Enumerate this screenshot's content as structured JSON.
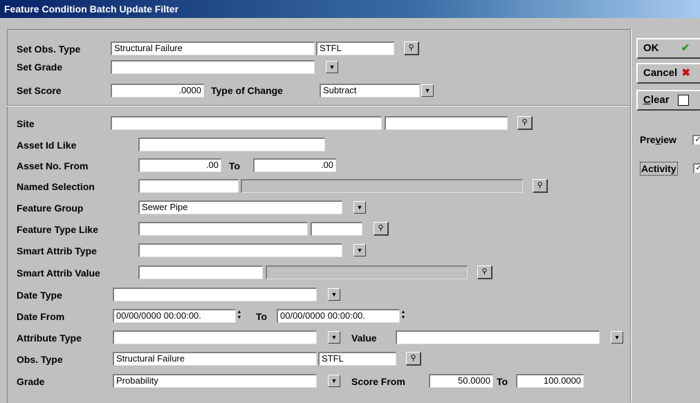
{
  "window": {
    "title": "Feature Condition Batch Update Filter"
  },
  "set": {
    "obs_type_label": "Set Obs. Type",
    "obs_type_value": "Structural Failure",
    "obs_type_code": "STFL",
    "grade_label": "Set Grade",
    "grade_value": "",
    "score_label": "Set Score",
    "score_value": ".0000",
    "change_label": "Type of Change",
    "change_value": "Subtract"
  },
  "filter": {
    "site_label": "Site",
    "site_value": "",
    "site_code": "",
    "asset_id_label": "Asset Id Like",
    "asset_id_value": "",
    "asset_no_label": "Asset No. From",
    "asset_no_from": ".00",
    "asset_no_to_label": "To",
    "asset_no_to": ".00",
    "named_sel_label": "Named Selection",
    "named_sel_value": "",
    "named_sel_desc": "",
    "feature_group_label": "Feature Group",
    "feature_group_value": "Sewer Pipe",
    "feature_type_label": "Feature Type Like",
    "feature_type_value": "",
    "feature_type_code": "",
    "smart_type_label": "Smart Attrib Type",
    "smart_type_value": "",
    "smart_value_label": "Smart Attrib Value",
    "smart_value_value": "",
    "smart_value_desc": "",
    "date_type_label": "Date Type",
    "date_type_value": "",
    "date_from_label": "Date From",
    "date_from_value": "00/00/0000 00:00:00.",
    "date_to_label": "To",
    "date_to_value": "00/00/0000 00:00:00.",
    "attr_type_label": "Attribute Type",
    "attr_type_value": "",
    "value_label": "Value",
    "value_value": "",
    "obs_type_label": "Obs. Type",
    "obs_type_value": "Structural Failure",
    "obs_type_code": "STFL",
    "grade_label": "Grade",
    "grade_value": "Probability",
    "score_from_label": "Score From",
    "score_from_value": "50.0000",
    "score_to_label": "To",
    "score_to_value": "100.0000"
  },
  "buttons": {
    "ok": "OK",
    "cancel": "Cancel",
    "clear": "Clear"
  },
  "checks": {
    "preview": "Preview",
    "activity": "Activity"
  },
  "icons": {
    "dropdown": "▼",
    "pick": "picker-icon",
    "ok": "checkmark-icon",
    "cancel": "x-icon"
  }
}
